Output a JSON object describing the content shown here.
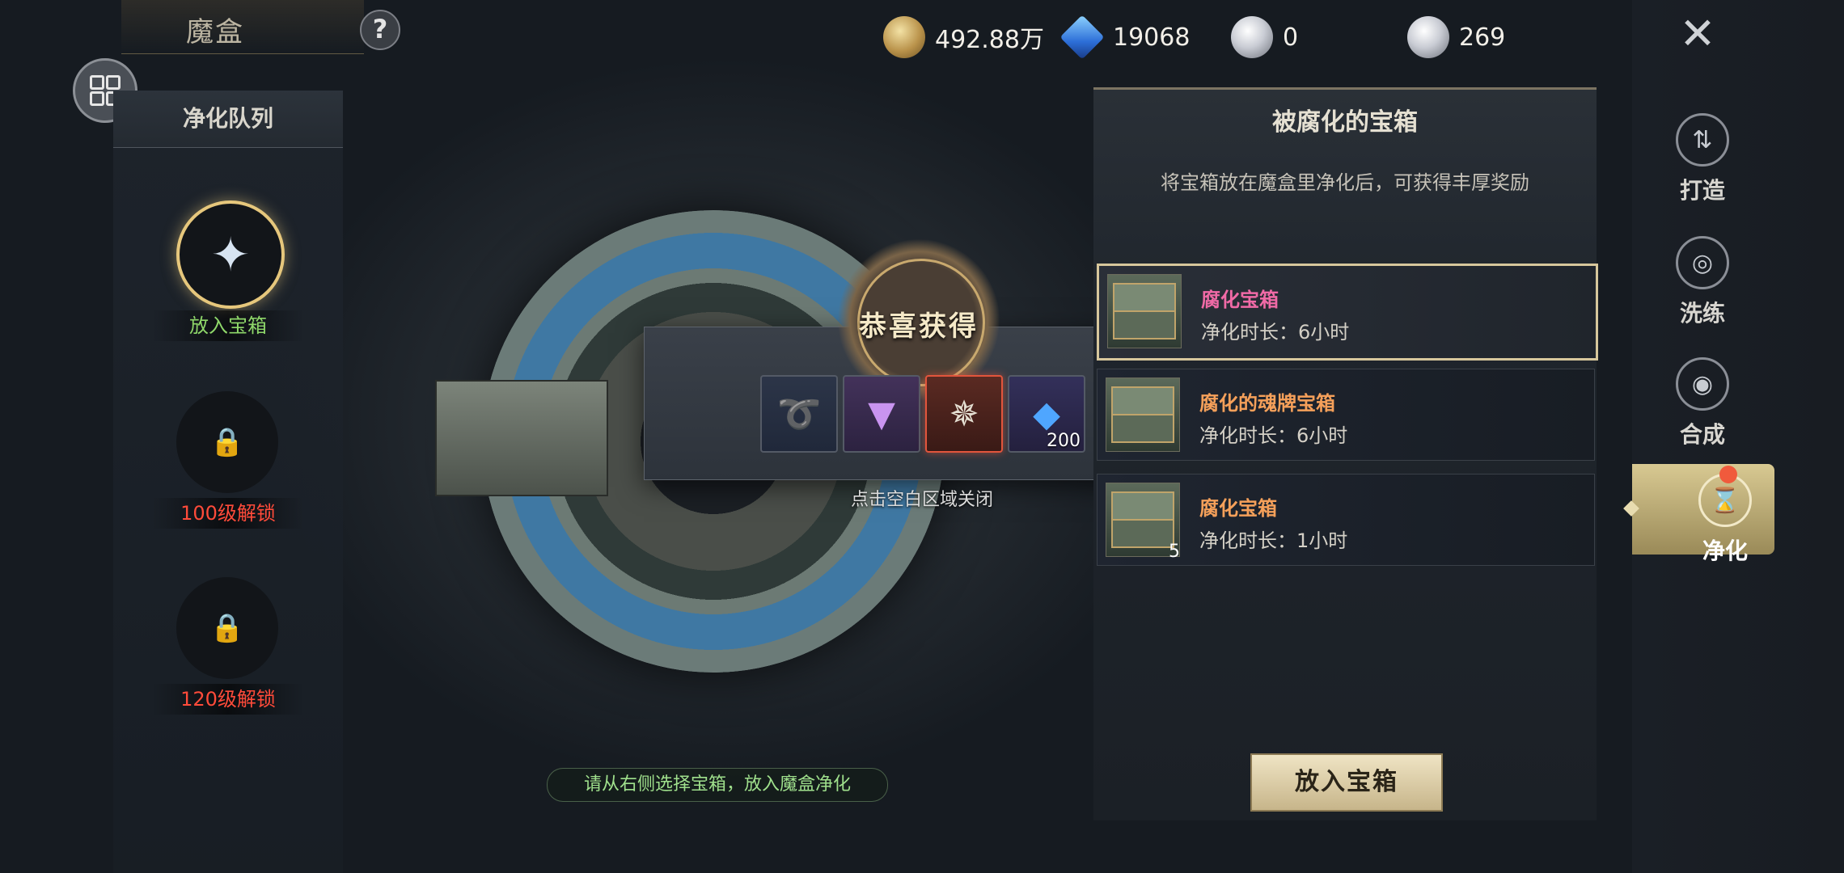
{
  "header": {
    "title": "魔盒",
    "help_label": "?",
    "close_label": "✕"
  },
  "currencies": [
    {
      "icon": "gold-coin-icon",
      "value": "492.88万"
    },
    {
      "icon": "blue-diamond-icon",
      "value": "19068"
    },
    {
      "icon": "locked-pearl-icon",
      "value": "0"
    },
    {
      "icon": "pearl-icon",
      "value": "269"
    }
  ],
  "queue": {
    "title": "净化队列",
    "slots": [
      {
        "label": "放入宝箱",
        "color": "#8fd86a",
        "state": "open"
      },
      {
        "label": "100级解锁",
        "color": "#ff4b3a",
        "state": "locked"
      },
      {
        "label": "120级解锁",
        "color": "#ff4b3a",
        "state": "locked"
      }
    ]
  },
  "popup": {
    "title": "恭喜获得",
    "rewards": [
      {
        "icon": "horn-icon",
        "count": ""
      },
      {
        "icon": "purple-crystal-icon",
        "count": ""
      },
      {
        "icon": "compass-relic-icon",
        "count": ""
      },
      {
        "icon": "blue-diamond-icon",
        "count": "200"
      }
    ],
    "close_hint": "点击空白区域关闭"
  },
  "instruction": "请从右侧选择宝箱，放入魔盒净化",
  "chest_panel": {
    "title": "被腐化的宝箱",
    "subtitle": "将宝箱放在魔盒里净化后，可获得丰厚奖励",
    "items": [
      {
        "name": "腐化宝箱",
        "duration": "净化时长：6小时",
        "count": "",
        "name_color": "#f06aa6",
        "selected": true
      },
      {
        "name": "腐化的魂牌宝箱",
        "duration": "净化时长：6小时",
        "count": "",
        "name_color": "#f5a05a",
        "selected": false
      },
      {
        "name": "腐化宝箱",
        "duration": "净化时长：1小时",
        "count": "5",
        "name_color": "#f5a05a",
        "selected": false
      }
    ],
    "put_button": "放入宝箱"
  },
  "nav": {
    "items": [
      {
        "label": "打造",
        "icon": "forge-icon",
        "active": false
      },
      {
        "label": "洗练",
        "icon": "refine-icon",
        "active": false
      },
      {
        "label": "合成",
        "icon": "combine-icon",
        "active": false
      },
      {
        "label": "净化",
        "icon": "purify-icon",
        "active": true
      }
    ]
  },
  "colors": {
    "accent_gold": "#d7c79c",
    "locked_red": "#ff4b3a",
    "open_green": "#8fd86a",
    "notification": "#f05a3c"
  }
}
